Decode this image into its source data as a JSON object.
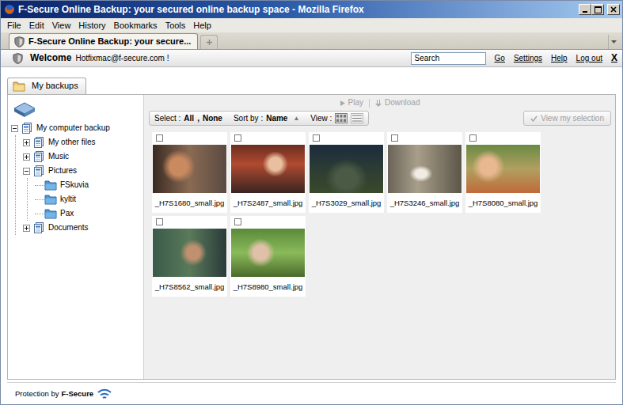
{
  "window": {
    "title": "F-Secure Online Backup: your secured online backup space - Mozilla Firefox"
  },
  "menu": [
    "File",
    "Edit",
    "View",
    "History",
    "Bookmarks",
    "Tools",
    "Help"
  ],
  "tabs": [
    {
      "label": "F-Secure Online Backup: your secure...",
      "selected": true
    }
  ],
  "header": {
    "welcome": "Welcome",
    "user": "Hotfixmac@f-secure.com !",
    "search_value": "Search",
    "go": "Go",
    "links": [
      "Settings",
      "Help",
      "Log out"
    ],
    "close": "X"
  },
  "page_tabs": [
    {
      "label": "My backups",
      "selected": true
    }
  ],
  "tree": {
    "items": [
      {
        "label": "My computer backup",
        "kind": "backup-set",
        "expanded": true,
        "children": [
          {
            "label": "My other files",
            "kind": "backup-set",
            "expanded": false
          },
          {
            "label": "Music",
            "kind": "backup-set",
            "expanded": false
          },
          {
            "label": "Pictures",
            "kind": "backup-set",
            "expanded": true,
            "children": [
              {
                "label": "FSkuvia",
                "kind": "folder"
              },
              {
                "label": "kyltit",
                "kind": "folder"
              },
              {
                "label": "Pax",
                "kind": "folder"
              }
            ]
          },
          {
            "label": "Documents",
            "kind": "backup-set",
            "expanded": false
          }
        ]
      }
    ]
  },
  "actions": [
    {
      "label": "Play",
      "kind": "play",
      "disabled": true
    },
    {
      "label": "Download",
      "kind": "download",
      "disabled": true
    }
  ],
  "selectbar": {
    "select_label": "Select :",
    "select_options": [
      "All",
      "None"
    ],
    "select_separator": ",",
    "sort_label": "Sort by :",
    "sort_value": "Name",
    "sort_indicator": "▲",
    "view_label": "View :",
    "view_modes": [
      {
        "kind": "grid",
        "selected": true
      },
      {
        "kind": "list",
        "selected": false
      }
    ]
  },
  "selection_button": {
    "label": "View my selection",
    "disabled": true
  },
  "files": [
    {
      "name": "_H7S1680_small.jpg",
      "checked": false
    },
    {
      "name": "_H7S2487_small.jpg",
      "checked": false
    },
    {
      "name": "_H7S3029_small.jpg",
      "checked": false
    },
    {
      "name": "_H7S3246_small.jpg",
      "checked": false
    },
    {
      "name": "_H7S8080_small.jpg",
      "checked": false
    },
    {
      "name": "_H7S8562_small.jpg",
      "checked": false
    },
    {
      "name": "_H7S8980_small.jpg",
      "checked": false
    }
  ],
  "footer": {
    "prefix": "Protection by",
    "brand": "F-Secure"
  }
}
